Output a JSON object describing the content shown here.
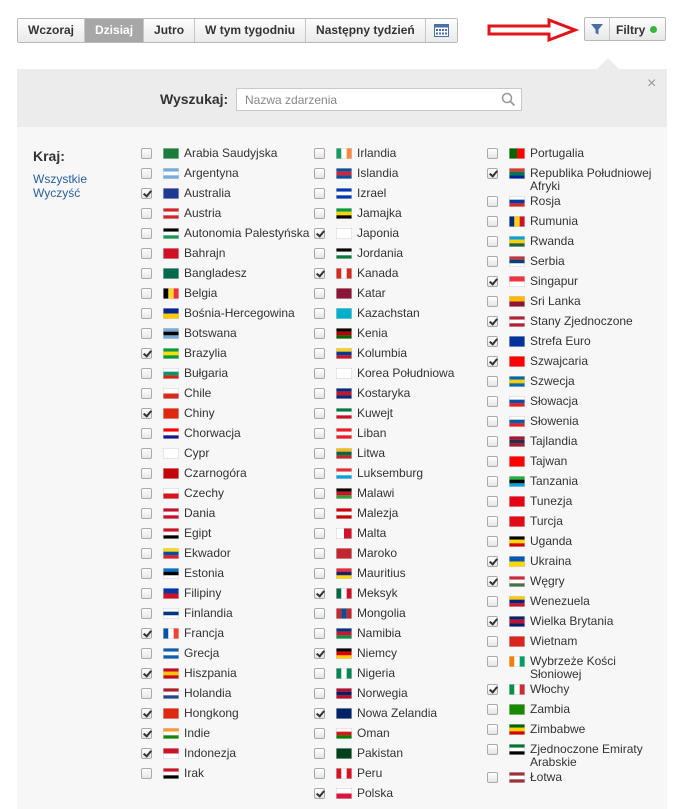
{
  "toolbar": {
    "tabs": [
      "Wczoraj",
      "Dzisiaj",
      "Jutro",
      "W tym tygodniu",
      "Następny tydzień"
    ],
    "active_index": 1,
    "filters_label": "Filtry"
  },
  "search": {
    "label": "Wyszukaj:",
    "placeholder": "Nazwa zdarzenia"
  },
  "country": {
    "label": "Kraj:",
    "all_label": "Wszystkie",
    "clear_label": "Wyczyść"
  },
  "close_glyph": "×",
  "countries": [
    [
      {
        "name": "Arabia Saudyjska",
        "checked": false,
        "flag": [
          "#1b7c3c",
          "#1b7c3c"
        ]
      },
      {
        "name": "Argentyna",
        "checked": false,
        "flag": [
          "#74acdf",
          "#ffffff",
          "#74acdf"
        ]
      },
      {
        "name": "Australia",
        "checked": true,
        "flag": [
          "#1f3a93",
          "#1f3a93"
        ]
      },
      {
        "name": "Austria",
        "checked": false,
        "flag": [
          "#d7212b",
          "#ffffff",
          "#d7212b"
        ]
      },
      {
        "name": "Autonomia Palestyńska",
        "checked": false,
        "flag": [
          "#000000",
          "#ffffff",
          "#149954"
        ]
      },
      {
        "name": "Bahrajn",
        "checked": false,
        "flag": [
          "#ce1126",
          "#ce1126"
        ]
      },
      {
        "name": "Bangladesz",
        "checked": false,
        "flag": [
          "#006a4e",
          "#006a4e"
        ]
      },
      {
        "name": "Belgia",
        "checked": false,
        "v": true,
        "flag": [
          "#000000",
          "#fdda24",
          "#ef3340"
        ]
      },
      {
        "name": "Bośnia-Hercegowina",
        "checked": false,
        "flag": [
          "#002395",
          "#fecb00"
        ]
      },
      {
        "name": "Botswana",
        "checked": false,
        "flag": [
          "#75aadb",
          "#000000",
          "#75aadb"
        ]
      },
      {
        "name": "Brazylia",
        "checked": true,
        "flag": [
          "#009c3b",
          "#ffdf00",
          "#009c3b"
        ]
      },
      {
        "name": "Bułgaria",
        "checked": false,
        "flag": [
          "#ffffff",
          "#00966e",
          "#d62612"
        ]
      },
      {
        "name": "Chile",
        "checked": false,
        "flag": [
          "#ffffff",
          "#d52b1e"
        ]
      },
      {
        "name": "Chiny",
        "checked": true,
        "flag": [
          "#de2910",
          "#de2910"
        ]
      },
      {
        "name": "Chorwacja",
        "checked": false,
        "flag": [
          "#ff0000",
          "#ffffff",
          "#171796"
        ]
      },
      {
        "name": "Cypr",
        "checked": false,
        "flag": [
          "#ffffff",
          "#ffffff"
        ]
      },
      {
        "name": "Czarnogóra",
        "checked": false,
        "flag": [
          "#c40308",
          "#c40308"
        ]
      },
      {
        "name": "Czechy",
        "checked": false,
        "flag": [
          "#ffffff",
          "#d7141a"
        ]
      },
      {
        "name": "Dania",
        "checked": false,
        "flag": [
          "#c8102e",
          "#ffffff",
          "#c8102e"
        ]
      },
      {
        "name": "Egipt",
        "checked": false,
        "flag": [
          "#ce1126",
          "#ffffff",
          "#000000"
        ]
      },
      {
        "name": "Ekwador",
        "checked": false,
        "flag": [
          "#ffdd00",
          "#034ea2",
          "#ed1c24"
        ]
      },
      {
        "name": "Estonia",
        "checked": false,
        "flag": [
          "#0072ce",
          "#000000",
          "#ffffff"
        ]
      },
      {
        "name": "Filipiny",
        "checked": false,
        "flag": [
          "#0038a8",
          "#ce1126"
        ]
      },
      {
        "name": "Finlandia",
        "checked": false,
        "flag": [
          "#ffffff",
          "#003580",
          "#ffffff"
        ]
      },
      {
        "name": "Francja",
        "checked": true,
        "v": true,
        "flag": [
          "#0055a4",
          "#ffffff",
          "#ef4135"
        ]
      },
      {
        "name": "Grecja",
        "checked": false,
        "flag": [
          "#0d5eaf",
          "#ffffff",
          "#0d5eaf"
        ]
      },
      {
        "name": "Hiszpania",
        "checked": true,
        "flag": [
          "#c60b1e",
          "#ffc400",
          "#c60b1e"
        ]
      },
      {
        "name": "Holandia",
        "checked": false,
        "flag": [
          "#ae1c28",
          "#ffffff",
          "#21468b"
        ]
      },
      {
        "name": "Hongkong",
        "checked": true,
        "flag": [
          "#de2910",
          "#de2910"
        ]
      },
      {
        "name": "Indie",
        "checked": true,
        "flag": [
          "#ff9933",
          "#ffffff",
          "#138808"
        ]
      },
      {
        "name": "Indonezja",
        "checked": true,
        "flag": [
          "#ce1126",
          "#ffffff"
        ]
      },
      {
        "name": "Irak",
        "checked": false,
        "flag": [
          "#ce1126",
          "#ffffff",
          "#000000"
        ]
      }
    ],
    [
      {
        "name": "Irlandia",
        "checked": false,
        "v": true,
        "flag": [
          "#169b62",
          "#ffffff",
          "#ff883e"
        ]
      },
      {
        "name": "Islandia",
        "checked": false,
        "flag": [
          "#02529c",
          "#dc1e35",
          "#02529c"
        ]
      },
      {
        "name": "Izrael",
        "checked": false,
        "flag": [
          "#0038b8",
          "#ffffff",
          "#0038b8"
        ]
      },
      {
        "name": "Jamajka",
        "checked": false,
        "flag": [
          "#009b3a",
          "#fed100",
          "#000000"
        ]
      },
      {
        "name": "Japonia",
        "checked": true,
        "flag": [
          "#ffffff",
          "#ffffff"
        ]
      },
      {
        "name": "Jordania",
        "checked": false,
        "flag": [
          "#000000",
          "#ffffff",
          "#007a3d"
        ]
      },
      {
        "name": "Kanada",
        "checked": true,
        "v": true,
        "flag": [
          "#d52b1e",
          "#ffffff",
          "#d52b1e"
        ]
      },
      {
        "name": "Katar",
        "checked": false,
        "flag": [
          "#8a1538",
          "#8a1538"
        ]
      },
      {
        "name": "Kazachstan",
        "checked": false,
        "flag": [
          "#00afca",
          "#00afca"
        ]
      },
      {
        "name": "Kenia",
        "checked": false,
        "flag": [
          "#000000",
          "#bb0000",
          "#006600"
        ]
      },
      {
        "name": "Kolumbia",
        "checked": false,
        "flag": [
          "#fcd116",
          "#003893",
          "#ce1126"
        ]
      },
      {
        "name": "Korea Południowa",
        "checked": false,
        "flag": [
          "#ffffff",
          "#ffffff"
        ]
      },
      {
        "name": "Kostaryka",
        "checked": false,
        "flag": [
          "#002b7f",
          "#ce1126",
          "#002b7f"
        ]
      },
      {
        "name": "Kuwejt",
        "checked": false,
        "flag": [
          "#007a3d",
          "#ffffff",
          "#ce1126"
        ]
      },
      {
        "name": "Liban",
        "checked": false,
        "flag": [
          "#ed1c24",
          "#ffffff",
          "#ed1c24"
        ]
      },
      {
        "name": "Litwa",
        "checked": false,
        "flag": [
          "#fdb913",
          "#006a44",
          "#c1272d"
        ]
      },
      {
        "name": "Luksemburg",
        "checked": false,
        "flag": [
          "#ed2939",
          "#ffffff",
          "#00a1de"
        ]
      },
      {
        "name": "Malawi",
        "checked": false,
        "flag": [
          "#000000",
          "#ce1126",
          "#339e35"
        ]
      },
      {
        "name": "Malezja",
        "checked": false,
        "flag": [
          "#cc0001",
          "#ffffff",
          "#cc0001"
        ]
      },
      {
        "name": "Malta",
        "checked": false,
        "v": true,
        "flag": [
          "#ffffff",
          "#cf142b"
        ]
      },
      {
        "name": "Maroko",
        "checked": false,
        "flag": [
          "#c1272d",
          "#c1272d"
        ]
      },
      {
        "name": "Mauritius",
        "checked": false,
        "flag": [
          "#ea2839",
          "#1a206d",
          "#ffd500"
        ]
      },
      {
        "name": "Meksyk",
        "checked": true,
        "v": true,
        "flag": [
          "#006847",
          "#ffffff",
          "#ce1126"
        ]
      },
      {
        "name": "Mongolia",
        "checked": false,
        "v": true,
        "flag": [
          "#c4272f",
          "#015197",
          "#c4272f"
        ]
      },
      {
        "name": "Namibia",
        "checked": false,
        "flag": [
          "#003580",
          "#d21034",
          "#009543"
        ]
      },
      {
        "name": "Niemcy",
        "checked": true,
        "flag": [
          "#000000",
          "#dd0000",
          "#ffce00"
        ]
      },
      {
        "name": "Nigeria",
        "checked": false,
        "v": true,
        "flag": [
          "#008751",
          "#ffffff",
          "#008751"
        ]
      },
      {
        "name": "Norwegia",
        "checked": false,
        "flag": [
          "#ba0c2f",
          "#00205b",
          "#ba0c2f"
        ]
      },
      {
        "name": "Nowa Zelandia",
        "checked": true,
        "flag": [
          "#012169",
          "#012169"
        ]
      },
      {
        "name": "Oman",
        "checked": false,
        "flag": [
          "#ffffff",
          "#db161b",
          "#008000"
        ]
      },
      {
        "name": "Pakistan",
        "checked": false,
        "flag": [
          "#01411c",
          "#01411c"
        ]
      },
      {
        "name": "Peru",
        "checked": false,
        "v": true,
        "flag": [
          "#d91023",
          "#ffffff",
          "#d91023"
        ]
      },
      {
        "name": "Polska",
        "checked": true,
        "flag": [
          "#ffffff",
          "#dc143c"
        ]
      }
    ],
    [
      {
        "name": "Portugalia",
        "checked": false,
        "v": true,
        "flag": [
          "#006600",
          "#ff0000"
        ]
      },
      {
        "name": "Republika Południowej Afryki",
        "checked": true,
        "flag": [
          "#de3831",
          "#007a4d",
          "#002395"
        ]
      },
      {
        "name": "Rosja",
        "checked": false,
        "flag": [
          "#ffffff",
          "#0039a6",
          "#d52b1e"
        ]
      },
      {
        "name": "Rumunia",
        "checked": false,
        "v": true,
        "flag": [
          "#002b7f",
          "#fcd116",
          "#ce1126"
        ]
      },
      {
        "name": "Rwanda",
        "checked": false,
        "flag": [
          "#00a1de",
          "#fad201",
          "#20603d"
        ]
      },
      {
        "name": "Serbia",
        "checked": false,
        "flag": [
          "#c6363c",
          "#0c4076",
          "#ffffff"
        ]
      },
      {
        "name": "Singapur",
        "checked": true,
        "flag": [
          "#ef3340",
          "#ffffff"
        ]
      },
      {
        "name": "Sri Lanka",
        "checked": false,
        "flag": [
          "#ffb700",
          "#8d153a"
        ]
      },
      {
        "name": "Stany Zjednoczone",
        "checked": true,
        "flag": [
          "#b22234",
          "#ffffff",
          "#b22234"
        ]
      },
      {
        "name": "Strefa Euro",
        "checked": true,
        "flag": [
          "#003399",
          "#003399"
        ]
      },
      {
        "name": "Szwajcaria",
        "checked": true,
        "flag": [
          "#ff0000",
          "#ff0000"
        ]
      },
      {
        "name": "Szwecja",
        "checked": false,
        "flag": [
          "#006aa7",
          "#fecc00",
          "#006aa7"
        ]
      },
      {
        "name": "Słowacja",
        "checked": false,
        "flag": [
          "#ffffff",
          "#0b4ea2",
          "#ee1c25"
        ]
      },
      {
        "name": "Słowenia",
        "checked": false,
        "flag": [
          "#ffffff",
          "#005da4",
          "#ed1c24"
        ]
      },
      {
        "name": "Tajlandia",
        "checked": false,
        "flag": [
          "#a51931",
          "#2d2a4a",
          "#a51931"
        ]
      },
      {
        "name": "Tajwan",
        "checked": false,
        "flag": [
          "#fe0000",
          "#fe0000"
        ]
      },
      {
        "name": "Tanzania",
        "checked": false,
        "flag": [
          "#1eb53a",
          "#000000",
          "#00a3dd"
        ]
      },
      {
        "name": "Tunezja",
        "checked": false,
        "flag": [
          "#e70013",
          "#e70013"
        ]
      },
      {
        "name": "Turcja",
        "checked": false,
        "flag": [
          "#e30a17",
          "#e30a17"
        ]
      },
      {
        "name": "Uganda",
        "checked": false,
        "flag": [
          "#000000",
          "#fcdc04",
          "#d90000"
        ]
      },
      {
        "name": "Ukraina",
        "checked": true,
        "flag": [
          "#0057b7",
          "#ffd700"
        ]
      },
      {
        "name": "Węgry",
        "checked": true,
        "flag": [
          "#ce2939",
          "#ffffff",
          "#477050"
        ]
      },
      {
        "name": "Wenezuela",
        "checked": false,
        "flag": [
          "#ffcc00",
          "#00247d",
          "#cf142b"
        ]
      },
      {
        "name": "Wielka Brytania",
        "checked": true,
        "flag": [
          "#012169",
          "#c8102e",
          "#012169"
        ]
      },
      {
        "name": "Wietnam",
        "checked": false,
        "flag": [
          "#da251d",
          "#da251d"
        ]
      },
      {
        "name": "Wybrzeże Kości Słoniowej",
        "checked": false,
        "v": true,
        "flag": [
          "#f77f00",
          "#ffffff",
          "#009e60"
        ]
      },
      {
        "name": "Włochy",
        "checked": true,
        "v": true,
        "flag": [
          "#009246",
          "#ffffff",
          "#ce2b37"
        ]
      },
      {
        "name": "Zambia",
        "checked": false,
        "flag": [
          "#198a00",
          "#198a00"
        ]
      },
      {
        "name": "Zimbabwe",
        "checked": false,
        "flag": [
          "#006400",
          "#ffd200",
          "#d40000"
        ]
      },
      {
        "name": "Zjednoczone Emiraty Arabskie",
        "checked": false,
        "flag": [
          "#00732f",
          "#ffffff",
          "#000000"
        ]
      },
      {
        "name": "Łotwa",
        "checked": false,
        "flag": [
          "#9e3039",
          "#ffffff",
          "#9e3039"
        ]
      }
    ]
  ]
}
